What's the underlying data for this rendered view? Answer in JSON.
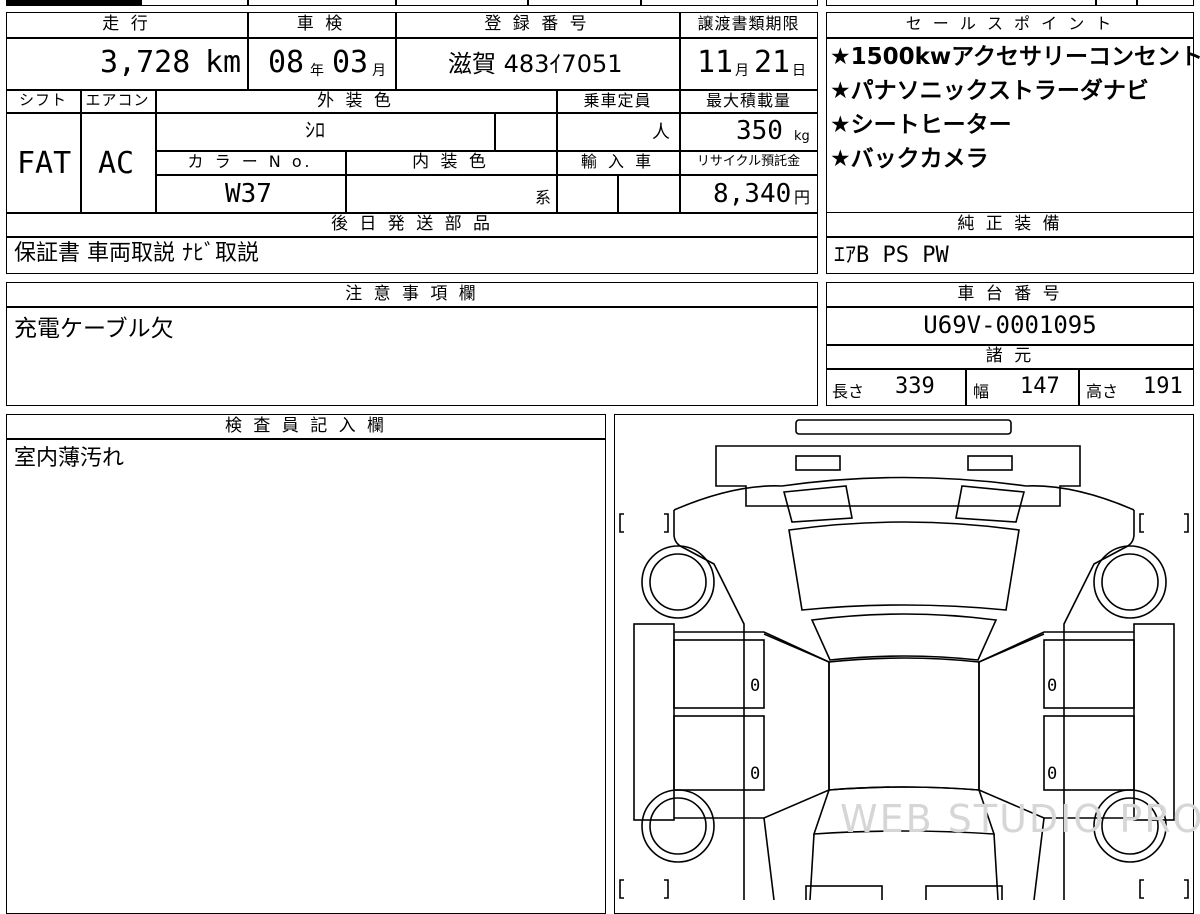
{
  "topTable": {
    "labels": {
      "mileage": "走 行",
      "inspection": "車 検",
      "registration": "登 録 番 号",
      "transferDeadline": "譲渡書類期限",
      "shift": "シフト",
      "aircon": "エアコン",
      "exteriorColor": "外 装 色",
      "capacity": "乗車定員",
      "maxLoad": "最大積載量",
      "colorNo": "カ ラ ー N o.",
      "interiorColor": "内 装 色",
      "imported": "輸 入 車",
      "recycleFee": "リサイクル預託金",
      "laterShipment": "後 日 発 送 部 品"
    },
    "values": {
      "mileage": "3,728",
      "mileageUnit": "km",
      "inspectionYear": "08",
      "yearUnit": "年",
      "inspectionMonth": "03",
      "monthUnit": "月",
      "registration": "滋賀 483ｲ7051",
      "transferMonth": "11",
      "transferDay": "21",
      "dayUnit": "日",
      "shift": "FAT",
      "aircon": "AC",
      "exteriorColor": "ｼﾛ",
      "capacityUnit": "人",
      "maxLoad": "350",
      "maxLoadUnit": "kg",
      "colorNo": "W37",
      "interiorSuffix": "系",
      "recycleFee": "8,340",
      "yenUnit": "円",
      "laterShipment": "保証書 車両取説 ﾅﾋﾞ取説"
    }
  },
  "salesPoints": {
    "title": "セ ー ル ス ポ イ ン ト",
    "items": [
      "★1500kwアクセサリーコンセント",
      "★パナソニックストラーダナビ",
      "★シートヒーター",
      "★バックカメラ"
    ]
  },
  "genuineEquipment": {
    "title": "純 正 装 備",
    "value": "ｴｱB PS PW"
  },
  "notes": {
    "title": "注 意 事 項 欄",
    "value": "充電ケーブル欠"
  },
  "chassis": {
    "title": "車 台 番 号",
    "value": "U69V-0001095",
    "specsTitle": "諸 元",
    "lengthLabel": "長さ",
    "length": "339",
    "widthLabel": "幅",
    "width": "147",
    "heightLabel": "高さ",
    "height": "191"
  },
  "inspector": {
    "title": "検 査 員 記 入 欄",
    "value": "室内薄汚れ"
  },
  "diagram": {
    "leftMarks": [
      "0",
      "0"
    ],
    "rightMarks": [
      "0",
      "0"
    ],
    "watermark": "WEB STUDIO PRO"
  }
}
